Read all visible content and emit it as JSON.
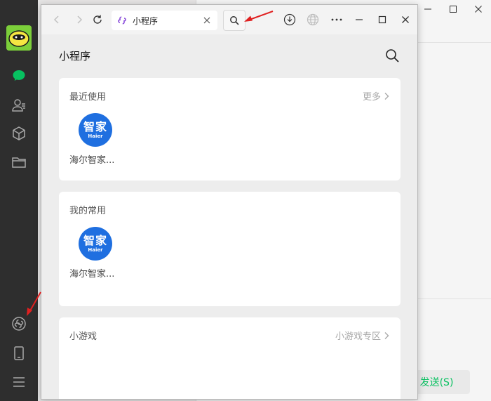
{
  "colors": {
    "accent_green": "#07c160",
    "rail_bg": "#2e2e2e",
    "window_bg": "#ededed",
    "card_bg": "#ffffff",
    "app_icon_blue": "#1f6fe0",
    "annotation_red": "#e02020"
  },
  "sidebar": {
    "icons": [
      "avatar",
      "chat-icon",
      "contacts-icon",
      "cube-icon",
      "folder-icon",
      "mini-program-icon",
      "phone-icon",
      "menu-icon"
    ]
  },
  "background": {
    "send_label": "发送(S)"
  },
  "miniprogram_window": {
    "tab": {
      "title": "小程序"
    },
    "page_title": "小程序",
    "sections": {
      "recent": {
        "title": "最近使用",
        "more_label": "更多",
        "apps": [
          {
            "name": "海尔智家...",
            "icon_text": "智家",
            "icon_subtext": "Haier"
          }
        ]
      },
      "favorites": {
        "title": "我的常用",
        "apps": [
          {
            "name": "海尔智家...",
            "icon_text": "智家",
            "icon_subtext": "Haier"
          }
        ]
      },
      "games": {
        "title": "小游戏",
        "more_label": "小游戏专区"
      }
    }
  }
}
